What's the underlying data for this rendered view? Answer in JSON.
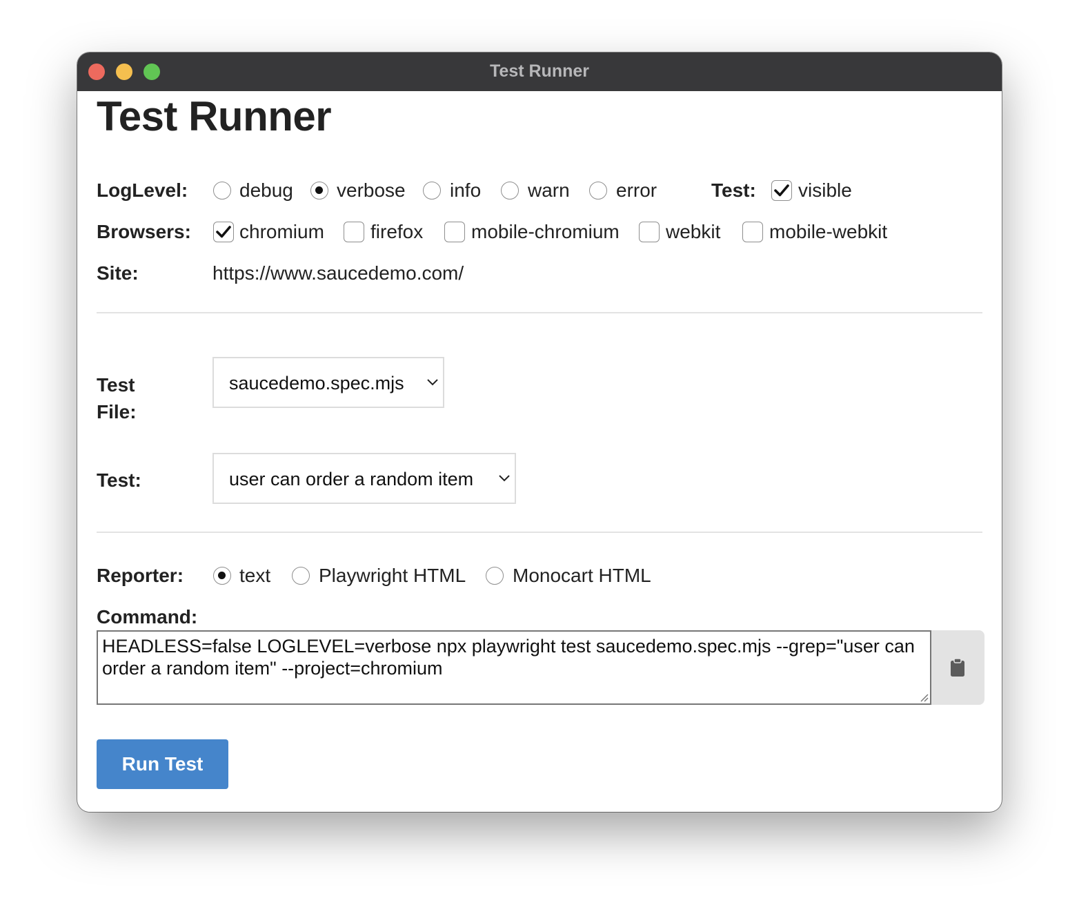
{
  "window": {
    "title": "Test Runner"
  },
  "page": {
    "heading": "Test Runner"
  },
  "loglevel": {
    "label": "LogLevel:",
    "options": [
      "debug",
      "verbose",
      "info",
      "warn",
      "error"
    ],
    "selected": "verbose"
  },
  "test_visibility": {
    "label": "Test:",
    "option": "visible",
    "checked": true
  },
  "browsers": {
    "label": "Browsers:",
    "options": [
      {
        "name": "chromium",
        "checked": true
      },
      {
        "name": "firefox",
        "checked": false
      },
      {
        "name": "mobile-chromium",
        "checked": false
      },
      {
        "name": "webkit",
        "checked": false
      },
      {
        "name": "mobile-webkit",
        "checked": false
      }
    ]
  },
  "site": {
    "label": "Site:",
    "url": "https://www.saucedemo.com/"
  },
  "test_file": {
    "label_line1": "Test",
    "label_line2": "File:",
    "selected": "saucedemo.spec.mjs"
  },
  "test": {
    "label": "Test:",
    "selected": "user can order a random item"
  },
  "reporter": {
    "label": "Reporter:",
    "options": [
      "text",
      "Playwright HTML",
      "Monocart HTML"
    ],
    "selected": "text"
  },
  "command": {
    "label": "Command:",
    "value": "HEADLESS=false LOGLEVEL=verbose npx playwright test saucedemo.spec.mjs --grep=\"user can order a random item\" --project=chromium"
  },
  "run_button": {
    "label": "Run Test"
  },
  "colors": {
    "titlebar": "#38383a",
    "run_button": "#4585cb",
    "traffic_red": "#ed6a5e",
    "traffic_yellow": "#f5bf4f",
    "traffic_green": "#61c554"
  }
}
